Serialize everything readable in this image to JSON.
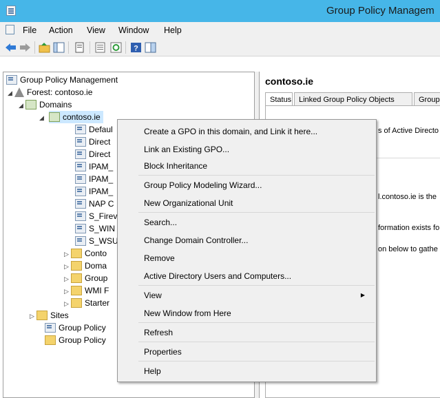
{
  "window": {
    "title": "Group Policy Managem"
  },
  "menubar": {
    "items": [
      "File",
      "Action",
      "View",
      "Window",
      "Help"
    ]
  },
  "toolbar": {
    "buttons": [
      "back-icon",
      "forward-icon",
      "up-folder-icon",
      "show-hide-tree-icon",
      "properties-icon",
      "export-list-icon",
      "refresh-icon",
      "help-icon",
      "console-tree-icon"
    ]
  },
  "tree": {
    "root": "Group Policy Management",
    "forest": "Forest: contoso.ie",
    "domains": "Domains",
    "domain": "contoso.ie",
    "children": [
      "Defaul",
      "Direct",
      "Direct",
      "IPAM_",
      "IPAM_",
      "IPAM_",
      "NAP C",
      "S_Firev",
      "S_WIN",
      "S_WSU",
      "Conto",
      "Doma",
      "Group",
      "WMI F",
      "Starter"
    ],
    "sites": "Sites",
    "bottom": [
      "Group Policy",
      "Group Policy"
    ]
  },
  "right_pane": {
    "title": "contoso.ie",
    "tabs": [
      "Status",
      "Linked Group Policy Objects",
      "Group"
    ],
    "text1": "s of Active Directo",
    "text2": "l.contoso.ie is the",
    "text3": "formation exists fo",
    "text4": "on below to gathe"
  },
  "context_menu": {
    "items": [
      "Create a GPO in this domain, and Link it here...",
      "Link an Existing GPO...",
      "Block Inheritance",
      "Group Policy Modeling Wizard...",
      "New Organizational Unit",
      "Search...",
      "Change Domain Controller...",
      "Remove",
      "Active Directory Users and Computers...",
      "View",
      "New Window from Here",
      "Refresh",
      "Properties",
      "Help"
    ]
  },
  "colors": {
    "titlebar": "#46b6e8",
    "background": "#f0f0f0",
    "selection": "#cce8ff"
  }
}
